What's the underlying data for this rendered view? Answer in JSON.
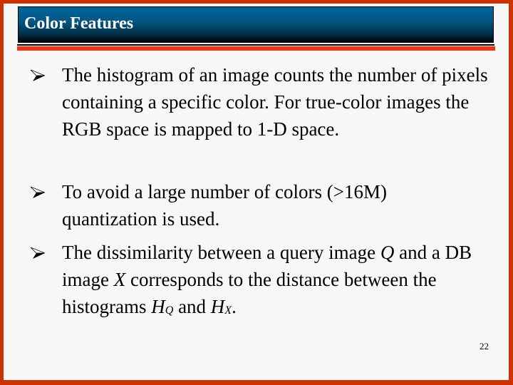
{
  "slide": {
    "title": "Color Features",
    "page_number": "22",
    "colors": {
      "frame": "#cc3300",
      "background": "#f7f7f7",
      "title_bar_top": "#02659c",
      "title_bar_bottom": "#000407",
      "accent_rule": "#ee3311"
    },
    "bullet_icon": "arrow-bullet-icon",
    "bullets": [
      {
        "text": "The histogram of an image counts the number of pixels containing a specific color. For true-color images the RGB space is mapped to 1-D space."
      },
      {
        "text": "To avoid a large number of colors (>16M) quantization is used."
      },
      {
        "prefix": "The dissimilarity between a query image ",
        "var_q": "Q",
        "mid1": " and a DB image ",
        "var_x": "X",
        "mid2": " corresponds to the distance between the histograms ",
        "h1": "H",
        "h1_sub": "Q",
        "mid3": " and ",
        "h2": "H",
        "h2_sub": "X",
        "suffix": "."
      }
    ]
  }
}
